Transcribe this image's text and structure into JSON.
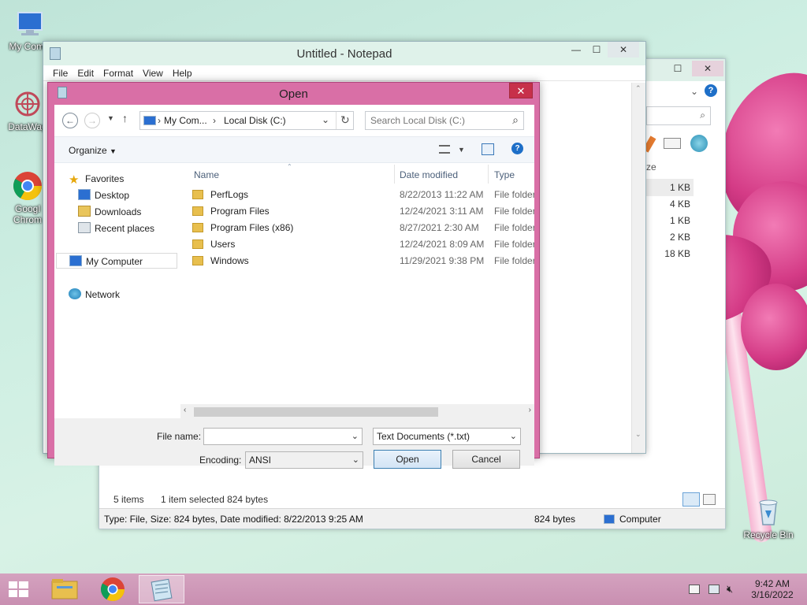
{
  "desktop": {
    "icons": [
      {
        "label": "My Comp"
      },
      {
        "label": "DataWag"
      },
      {
        "label": "Googl Chrom"
      },
      {
        "label": "Recycle Bin"
      }
    ]
  },
  "explorer": {
    "sizes": [
      "1 KB",
      "4 KB",
      "1 KB",
      "2 KB",
      "18 KB"
    ],
    "col_size": "ze",
    "status_items": "5 items",
    "status_selected": "1 item selected  824 bytes",
    "details_text": "Type: File, Size: 824 bytes, Date modified: 8/22/2013 9:25 AM",
    "details_size": "824 bytes",
    "details_location": "Computer"
  },
  "notepad": {
    "title": "Untitled - Notepad",
    "menu": [
      "File",
      "Edit",
      "Format",
      "View",
      "Help"
    ]
  },
  "dialog": {
    "title": "Open",
    "breadcrumb": [
      "My Com...",
      "Local Disk (C:)"
    ],
    "search_placeholder": "Search Local Disk (C:)",
    "organize_label": "Organize",
    "nav_tree": {
      "favorites": "Favorites",
      "desktop": "Desktop",
      "downloads": "Downloads",
      "recent": "Recent places",
      "my_computer": "My Computer",
      "network": "Network"
    },
    "columns": {
      "name": "Name",
      "date": "Date modified",
      "type": "Type"
    },
    "files": [
      {
        "name": "PerfLogs",
        "date": "8/22/2013 11:22 AM",
        "type": "File folder"
      },
      {
        "name": "Program Files",
        "date": "12/24/2021 3:11 AM",
        "type": "File folder"
      },
      {
        "name": "Program Files (x86)",
        "date": "8/27/2021 2:30 AM",
        "type": "File folder"
      },
      {
        "name": "Users",
        "date": "12/24/2021 8:09 AM",
        "type": "File folder"
      },
      {
        "name": "Windows",
        "date": "11/29/2021 9:38 PM",
        "type": "File folder"
      }
    ],
    "file_name_label": "File name:",
    "file_name_value": "",
    "file_type_value": "Text Documents (*.txt)",
    "encoding_label": "Encoding:",
    "encoding_value": "ANSI",
    "open_label": "Open",
    "cancel_label": "Cancel"
  },
  "taskbar": {
    "time": "9:42 AM",
    "date": "3/16/2022"
  },
  "colors": {
    "dialog_frame": "#d96fa6",
    "close_red": "#c7304a",
    "taskbar": "#c98fb1"
  }
}
